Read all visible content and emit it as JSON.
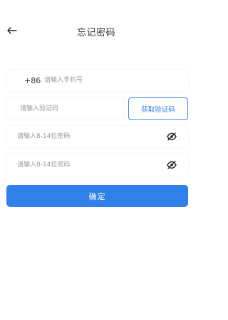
{
  "header": {
    "title": "忘记密码",
    "back_icon": "arrow-left-icon"
  },
  "form": {
    "phone": {
      "prefix": "+86",
      "placeholder": "请输入手机号",
      "value": ""
    },
    "code": {
      "placeholder": "请输入验证码",
      "value": "",
      "button_label": "获取验证码"
    },
    "password": {
      "placeholder": "请输入8-14位密码",
      "value": "",
      "toggle_icon": "eye-off-icon"
    },
    "confirm_password": {
      "placeholder": "请输入8-14位密码",
      "value": "",
      "toggle_icon": "eye-off-icon"
    },
    "submit_label": "确定"
  },
  "colors": {
    "accent": "#2f80e8",
    "text": "#333333",
    "placeholder": "#9a9a9a",
    "background": "#ffffff"
  }
}
